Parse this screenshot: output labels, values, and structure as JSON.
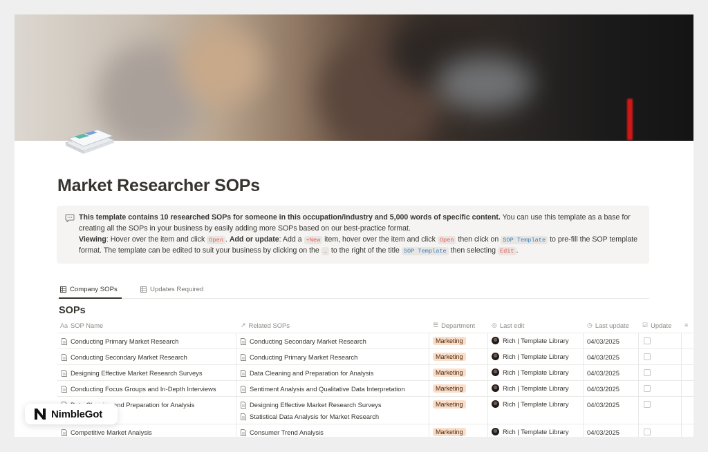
{
  "page": {
    "title": "Market Researcher SOPs"
  },
  "callout": {
    "bold_intro": "This template contains 10 researched SOPs for someone in this occupation/industry and 5,000 words of specific content.",
    "intro_rest": " You can use this template as a base for creating all the SOPs in your business by easily adding more SOPs based on our best-practice format.",
    "viewing_label": "Viewing",
    "viewing_text": ": Hover over the item and click ",
    "open_code": "Open",
    "add_label": "Add or update",
    "add_text_1": ": Add a ",
    "new_code": "+New",
    "add_text_2": " item, hover over the item and click ",
    "add_text_3": " then click on ",
    "sop_template_code": "SOP Template",
    "add_text_4": " to pre-fill the SOP template format. The template can be edited to suit your business by clicking on the ",
    "dots_code": "…",
    "add_text_5": " to the right of the title ",
    "add_text_6": " then selecting ",
    "edit_code": "Edit",
    "add_text_7": "."
  },
  "tabs": [
    {
      "label": "Company SOPs",
      "active": true
    },
    {
      "label": "Updates Required",
      "active": false
    }
  ],
  "database": {
    "title": "SOPs",
    "columns": {
      "name": "SOP Name",
      "related": "Related SOPs",
      "department": "Department",
      "last_edit": "Last edit",
      "last_update": "Last update",
      "update": "Update"
    },
    "rows": [
      {
        "name": "Conducting Primary Market Research",
        "related": [
          "Conducting Secondary Market Research"
        ],
        "department": "Marketing",
        "editor": "Rich | Template Library",
        "date": "04/03/2025",
        "update": false
      },
      {
        "name": "Conducting Secondary Market Research",
        "related": [
          "Conducting Primary Market Research"
        ],
        "department": "Marketing",
        "editor": "Rich | Template Library",
        "date": "04/03/2025",
        "update": false
      },
      {
        "name": "Designing Effective Market Research Surveys",
        "related": [
          "Data Cleaning and Preparation for Analysis"
        ],
        "department": "Marketing",
        "editor": "Rich | Template Library",
        "date": "04/03/2025",
        "update": false
      },
      {
        "name": "Conducting Focus Groups and In-Depth Interviews",
        "related": [
          "Sentiment Analysis and Qualitative Data Interpretation"
        ],
        "department": "Marketing",
        "editor": "Rich | Template Library",
        "date": "04/03/2025",
        "update": false
      },
      {
        "name": "Data Cleaning and Preparation for Analysis",
        "related": [
          "Designing Effective Market Research Surveys",
          "Statistical Data Analysis for Market Research"
        ],
        "department": "Marketing",
        "editor": "Rich | Template Library",
        "date": "04/03/2025",
        "update": false
      },
      {
        "name": "Competitive Market Analysis",
        "related": [
          "Consumer Trend Analysis"
        ],
        "department": "Marketing",
        "editor": "Rich | Template Library",
        "date": "04/03/2025",
        "update": false
      }
    ]
  },
  "badge": {
    "text": "NimbleGot"
  }
}
